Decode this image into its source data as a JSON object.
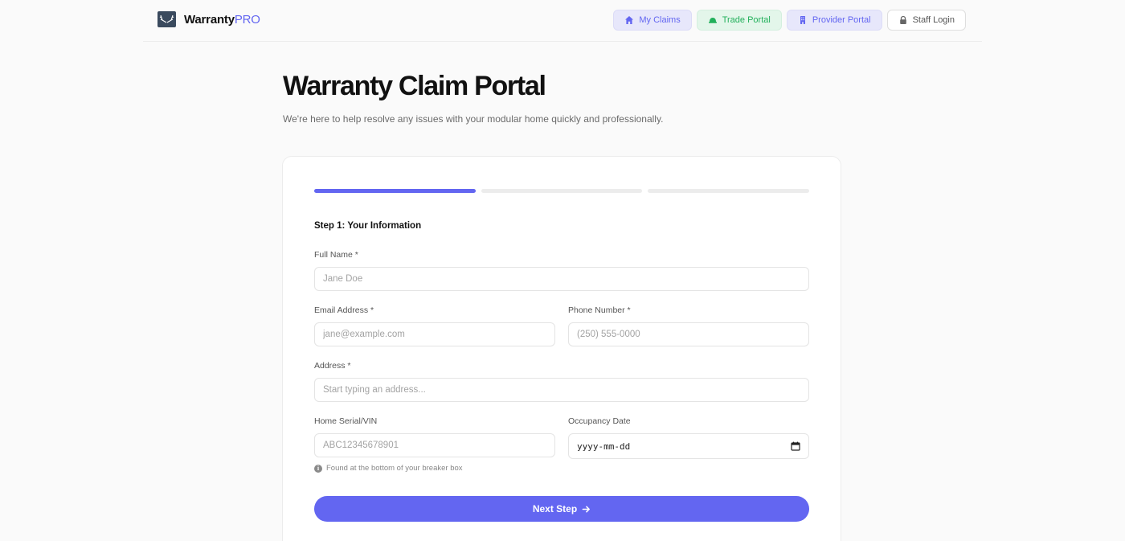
{
  "brand": {
    "name": "Warranty",
    "suffix": "PRO"
  },
  "nav": {
    "my_claims": "My Claims",
    "trade_portal": "Trade Portal",
    "provider_portal": "Provider Portal",
    "staff_login": "Staff Login"
  },
  "hero": {
    "title": "Warranty Claim Portal",
    "subtitle": "We're here to help resolve any issues with your modular home quickly and professionally."
  },
  "progress": {
    "current_step": 1,
    "total_steps": 3
  },
  "form": {
    "step_title": "Step 1: Your Information",
    "full_name": {
      "label": "Full Name *",
      "placeholder": "Jane Doe"
    },
    "email": {
      "label": "Email Address *",
      "placeholder": "jane@example.com"
    },
    "phone": {
      "label": "Phone Number *",
      "placeholder": "(250) 555-0000"
    },
    "address": {
      "label": "Address *",
      "placeholder": "Start typing an address..."
    },
    "serial": {
      "label": "Home Serial/VIN",
      "placeholder": "ABC12345678901"
    },
    "occupancy": {
      "label": "Occupancy Date",
      "value": "yyyy-mm-dd"
    },
    "serial_hint": "Found at the bottom of your breaker box",
    "next_label": "Next Step"
  },
  "colors": {
    "accent": "#6366f1",
    "success": "#22b05b",
    "text": "#111111",
    "muted": "#6b6b6b"
  },
  "icons": {
    "logo": "antler-logo-icon",
    "my_claims": "home-icon",
    "trade_portal": "hard-hat-icon",
    "provider_portal": "building-icon",
    "staff_login": "lock-icon",
    "hint": "info-icon",
    "date": "calendar-icon",
    "next": "arrow-right-icon"
  }
}
